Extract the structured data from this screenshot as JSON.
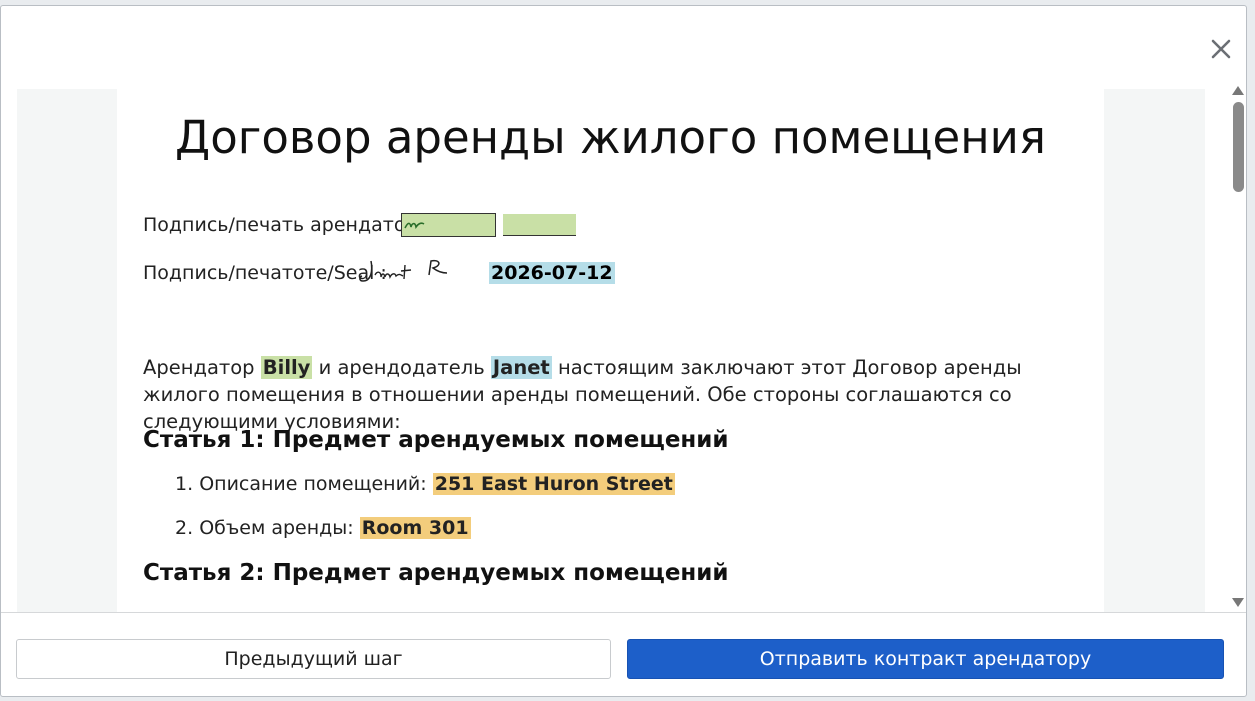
{
  "document": {
    "title": "Договор аренды жилого помещения",
    "tenant_sig_label": "Подпись/печать арендатора :",
    "landlord_sig_label": "Подпись/печатоте/Seal :",
    "signature_date": "2026-07-12",
    "intro": {
      "part1": "Арендатор ",
      "tenant_name": "Billy",
      "part2": " и арендодатель ",
      "landlord_name": "Janet",
      "part3": " настоящим заключают этот Договор аренды жилого помещения в отношении аренды помещений. Обе стороны соглашаются со следующими условиями:"
    },
    "article1_heading": "Статья 1: Предмет арендуемых помещений",
    "items": [
      {
        "number": "1.",
        "label": "Описание помещений:",
        "value": "251 East Huron Street"
      },
      {
        "number": "2.",
        "label": "Объем аренды:",
        "value": "Room 301"
      }
    ],
    "article2_heading": "Статья 2: Предмет арендуемых помещений"
  },
  "footer": {
    "prev_label": "Предыдущий шаг",
    "send_label": "Отправить контракт арендатору"
  },
  "colors": {
    "highlight_green": "#c9e0a6",
    "highlight_blue": "#b5dde8",
    "highlight_orange": "#f3cd7c",
    "primary_button": "#1d5fc9"
  }
}
